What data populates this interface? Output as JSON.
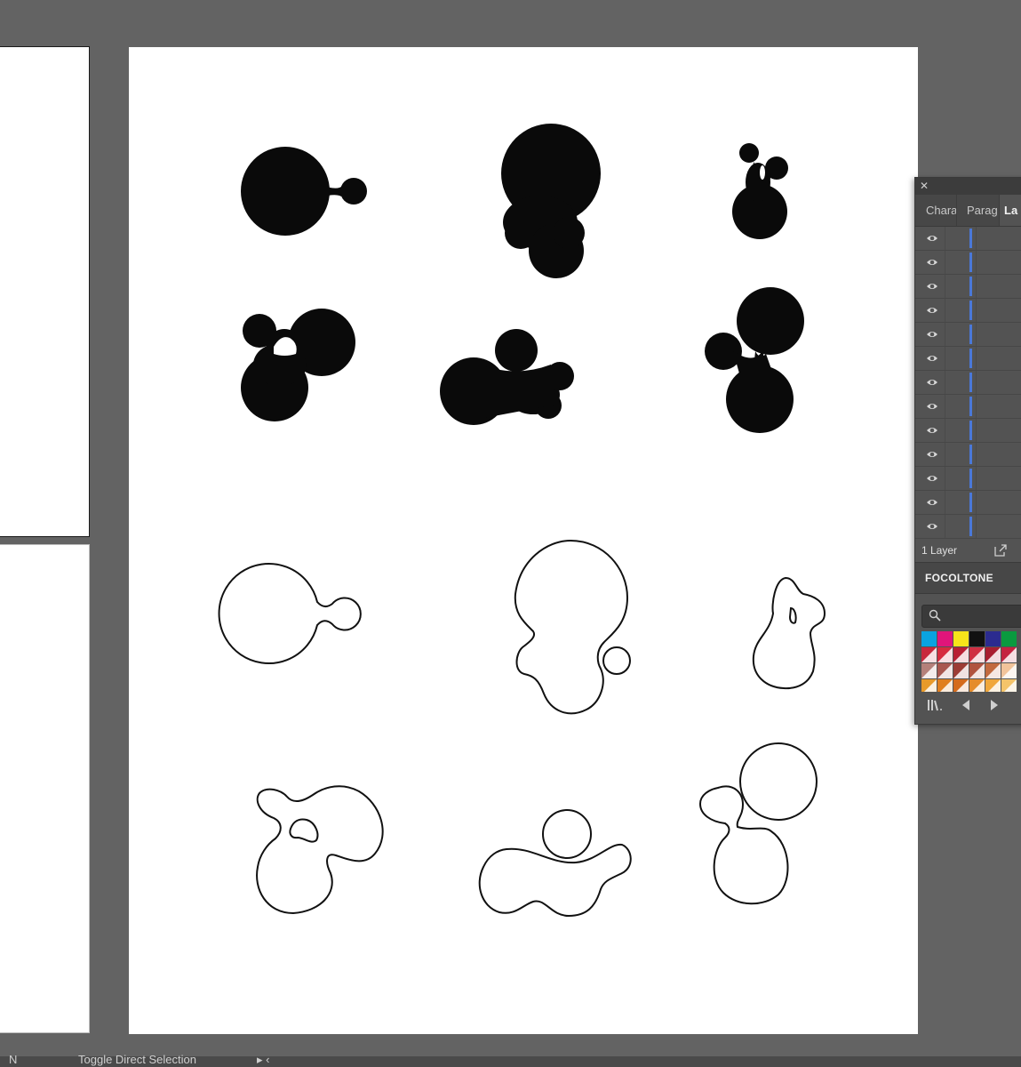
{
  "canvas": {
    "background": "#636363",
    "artboard_color": "#ffffff"
  },
  "artwork": {
    "fill_color": "#0a0a0a",
    "outline_color": "#111111",
    "filled_shape_names": [
      "blob-circle-small",
      "blob-bulb",
      "blob-hand",
      "blob-cluster",
      "blob-wave",
      "blob-tower"
    ],
    "outlined_shape_names": [
      "blob-circle-small-outline",
      "blob-bulb-outline",
      "blob-hand-outline",
      "blob-cluster-outline",
      "blob-wave-outline",
      "blob-tower-outline"
    ]
  },
  "layers_panel": {
    "close_icon": "close-icon",
    "tabs": [
      {
        "label": "Chara"
      },
      {
        "label": "Parag"
      },
      {
        "label": "La"
      }
    ],
    "layer_row_count": 13,
    "visibility_icon": "eye-icon",
    "layer_color": "#4a78d8",
    "footer_label": "1 Layer",
    "export_icon": "export-icon"
  },
  "swatch_panel": {
    "title": "FOCOLTONE",
    "search_icon": "search-icon",
    "swatch_rows": [
      [
        "#0aa3e0",
        "#e0157a",
        "#f7e41a",
        "#111111",
        "#2b2b8f",
        "#0a9a3f"
      ],
      [
        "#c8283c",
        "#d62a3e",
        "#b81f33",
        "#cf2f42",
        "#a81e30",
        "#c42440"
      ],
      [
        "#b5807a",
        "#a9574f",
        "#9c3c35",
        "#b0533f",
        "#c2693e",
        "#f2c49a"
      ],
      [
        "#e89a2a",
        "#e07f1f",
        "#d46b1b",
        "#e58c2b",
        "#f0a73a",
        "#f5c46a"
      ]
    ],
    "footer_icons": [
      "library-icon",
      "previous-icon",
      "next-icon"
    ]
  },
  "status_bar": {
    "left_glyph": "N",
    "text": "Toggle Direct Selection",
    "arrows": "▸ ‹"
  }
}
